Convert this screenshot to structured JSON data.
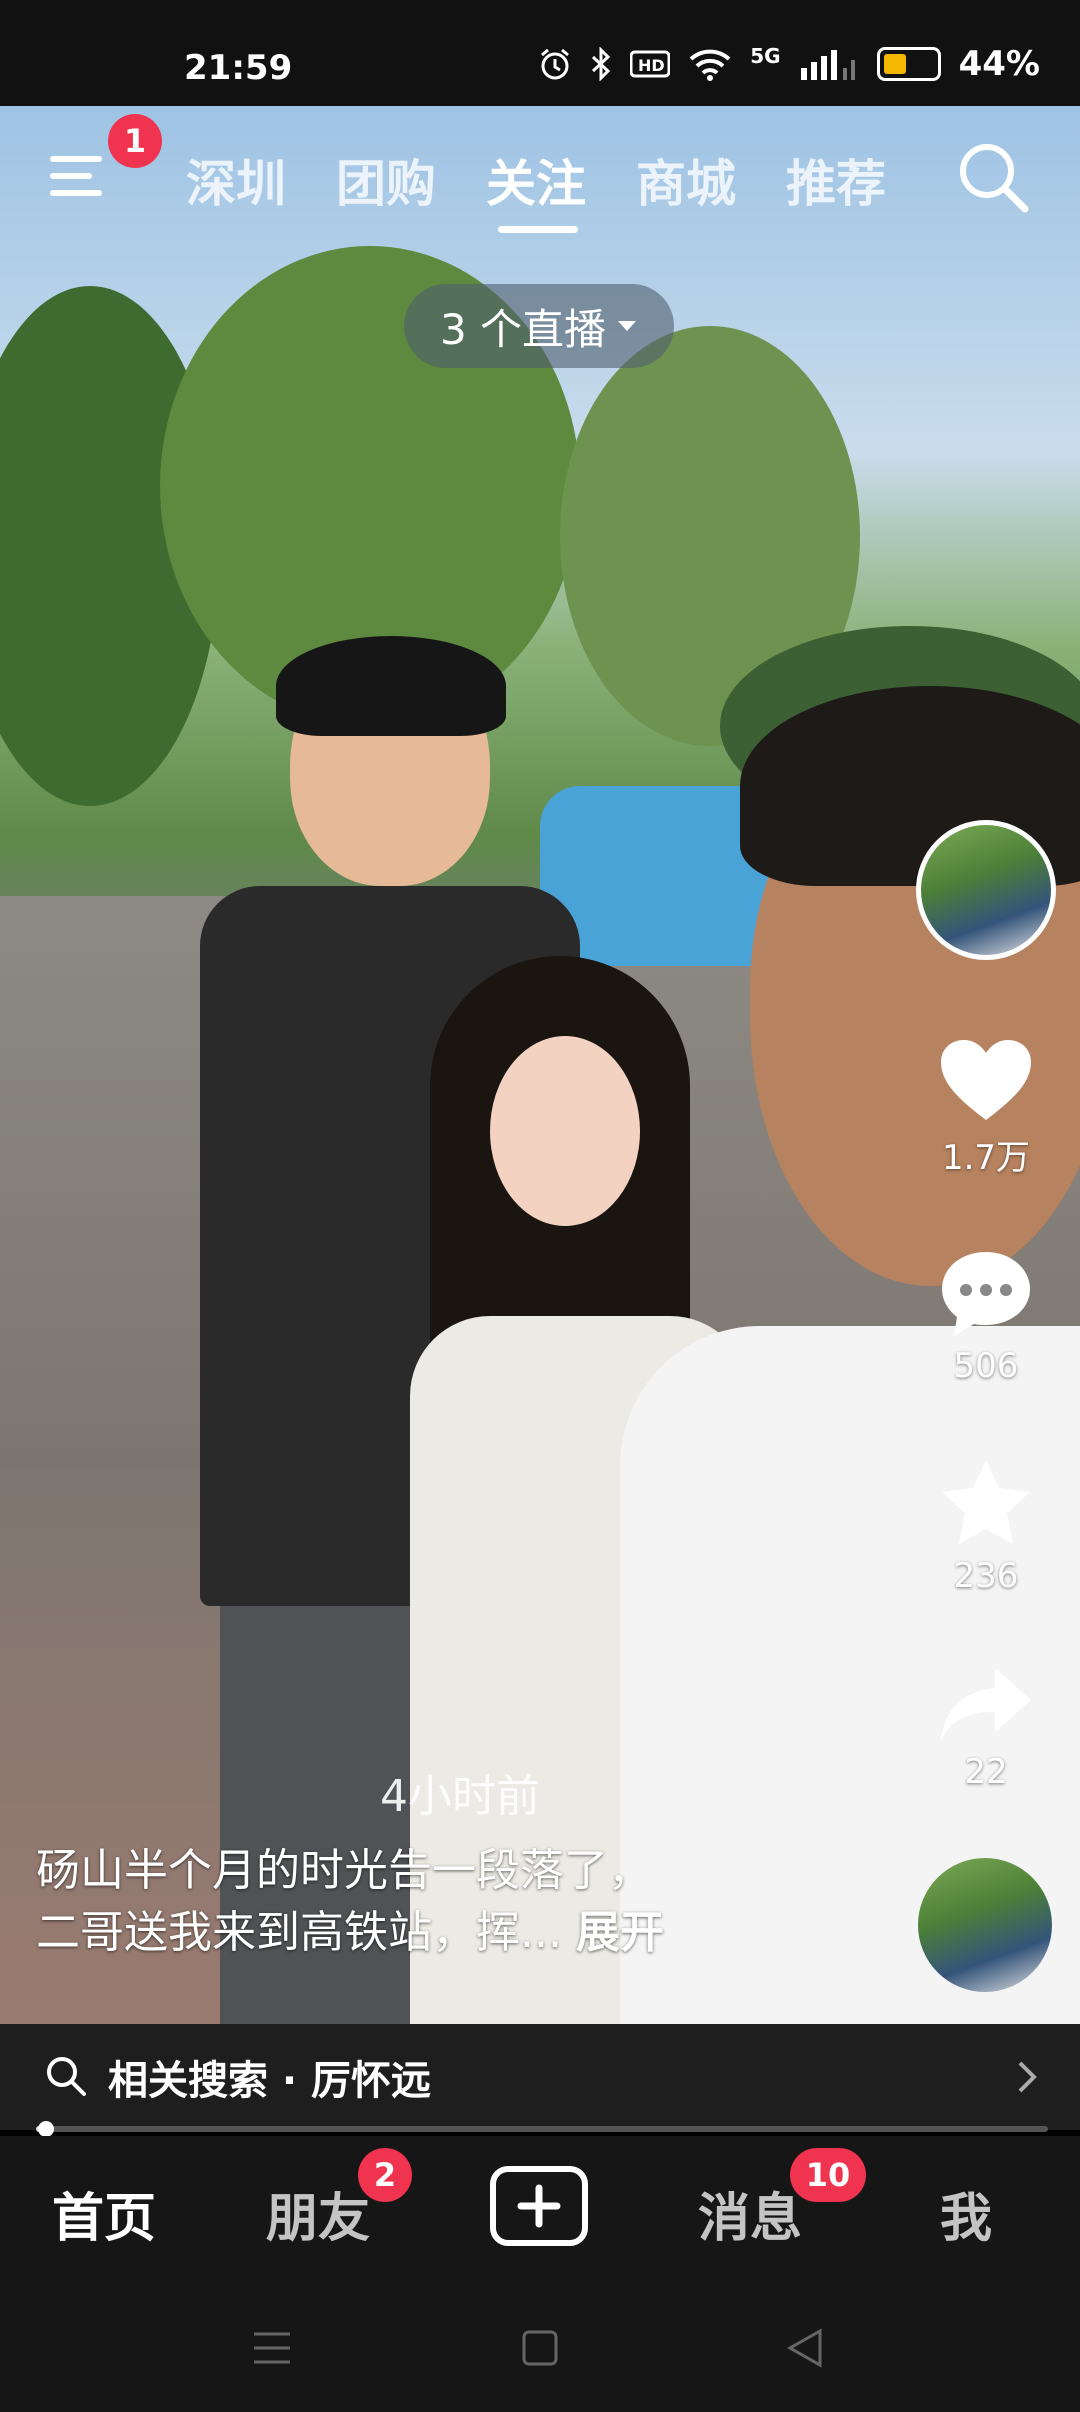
{
  "status_bar": {
    "time": "21:59",
    "network": "5G",
    "battery_percent": "44%",
    "battery_level": 0.44,
    "icons": [
      "alarm-icon",
      "bluetooth-icon",
      "hd-icon",
      "wifi-icon",
      "signal-icon",
      "battery-icon"
    ]
  },
  "top_nav": {
    "menu_badge": "1",
    "tabs": [
      {
        "label": "深圳"
      },
      {
        "label": "团购"
      },
      {
        "label": "关注"
      },
      {
        "label": "商城"
      },
      {
        "label": "推荐"
      }
    ],
    "active_tab": "关注"
  },
  "live_pill": {
    "label": "3 个直播"
  },
  "actions": {
    "likes": "1.7万",
    "comments": "506",
    "favorites": "236",
    "shares": "22"
  },
  "post": {
    "time_ago": "4小时前",
    "caption_line1": "砀山半个月的时光告一段落了，",
    "caption_line2": "二哥送我来到高铁站，挥...",
    "expand_label": "展开"
  },
  "related_search": {
    "label": "相关搜索 · 厉怀远"
  },
  "playback": {
    "progress": 0.01
  },
  "bottom_nav": {
    "items": [
      {
        "label": "首页"
      },
      {
        "label": "朋友",
        "badge": "2"
      },
      {
        "label": "消息",
        "badge": "10"
      },
      {
        "label": "我"
      }
    ]
  },
  "colors": {
    "badge": "#f0334f",
    "battery": "#f5b800",
    "bar_bg": "#1e1e1e"
  }
}
